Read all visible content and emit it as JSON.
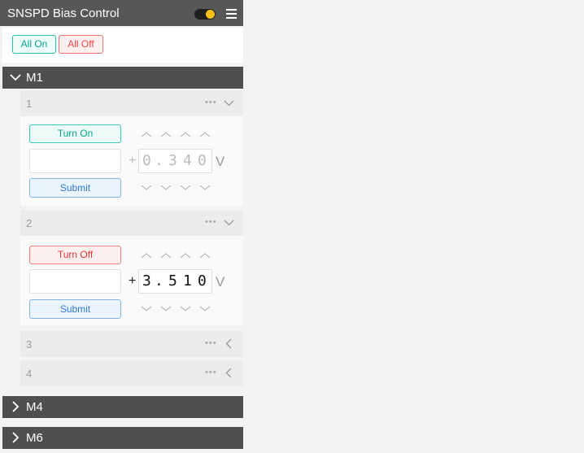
{
  "header": {
    "title": "SNSPD Bias Control",
    "theme_toggle_icon": "sun-icon",
    "menu_icon": "hamburger-menu-icon"
  },
  "actions": {
    "all_on_label": "All On",
    "all_off_label": "All Off"
  },
  "modules": [
    {
      "label": "M1",
      "expanded": true
    },
    {
      "label": "M4",
      "expanded": false
    },
    {
      "label": "M6",
      "expanded": false
    }
  ],
  "channels": [
    {
      "number": "1",
      "more": "•••",
      "expanded": true,
      "toggle_label": "Turn On",
      "sign": "+",
      "digits": [
        "0",
        ".",
        "3",
        "4",
        "0"
      ],
      "unit": "V",
      "submit_label": "Submit",
      "state": "off"
    },
    {
      "number": "2",
      "more": "•••",
      "expanded": true,
      "toggle_label": "Turn Off",
      "sign": "+",
      "digits": [
        "3",
        ".",
        "5",
        "1",
        "0"
      ],
      "unit": "V",
      "submit_label": "Submit",
      "state": "on"
    },
    {
      "number": "3",
      "more": "•••",
      "expanded": false
    },
    {
      "number": "4",
      "more": "•••",
      "expanded": false
    }
  ],
  "colors": {
    "header_bg": "#575757",
    "section_bg": "#4f4f4f",
    "on_accent": "#0aa58c",
    "off_accent": "#e33",
    "submit_accent": "#2f7ad0"
  }
}
